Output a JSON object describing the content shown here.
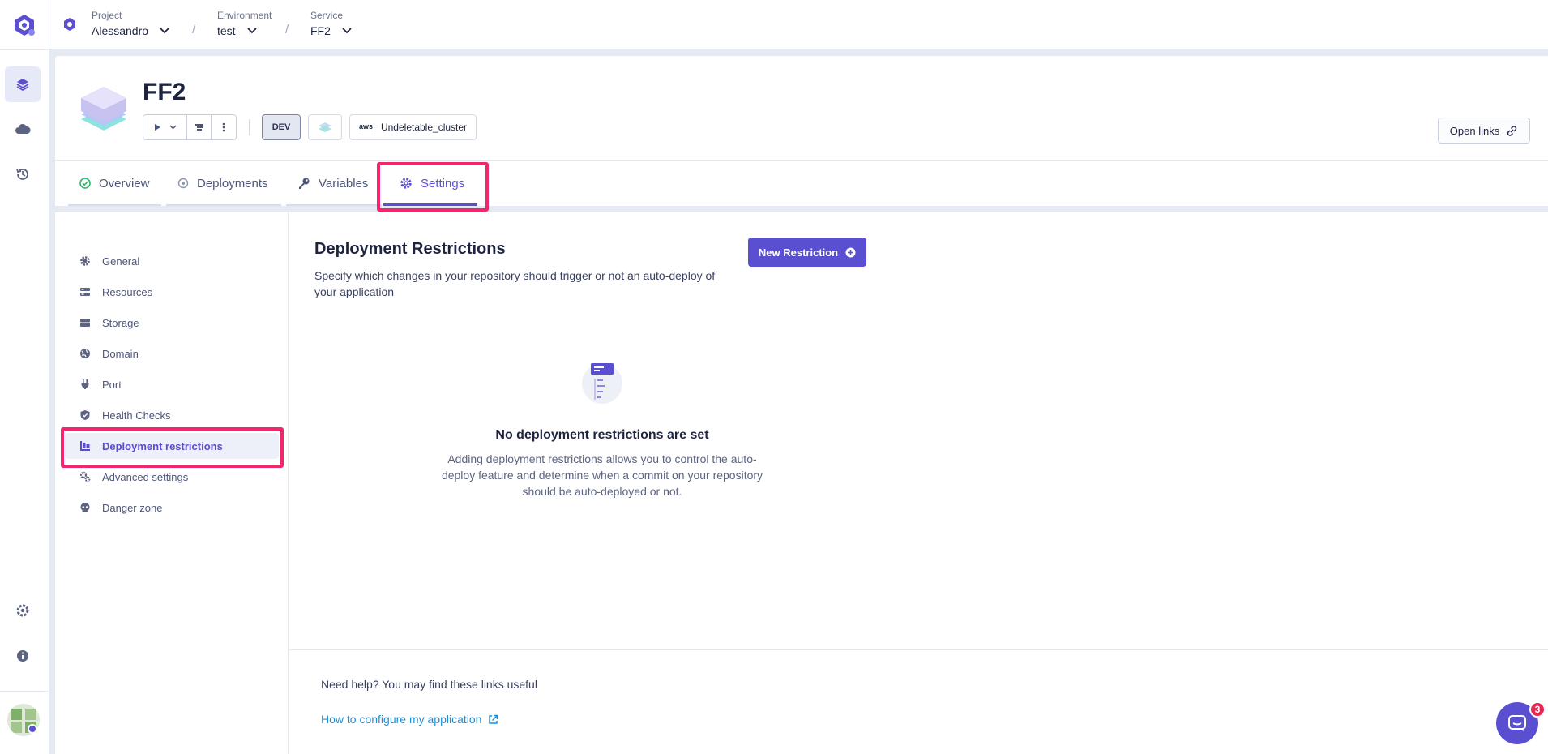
{
  "breadcrumb": {
    "project": {
      "label": "Project",
      "value": "Alessandro"
    },
    "environment": {
      "label": "Environment",
      "value": "test"
    },
    "service": {
      "label": "Service",
      "value": "FF2"
    },
    "separator": "/"
  },
  "app": {
    "title": "FF2",
    "env_badge": "DEV",
    "cluster": "Undeletable_cluster",
    "cluster_provider": "aws",
    "open_links_label": "Open links"
  },
  "tabs": [
    {
      "label": "Overview",
      "icon": "check-circle-icon"
    },
    {
      "label": "Deployments",
      "icon": "circle-dot-icon"
    },
    {
      "label": "Variables",
      "icon": "key-icon"
    },
    {
      "label": "Settings",
      "icon": "gear-icon",
      "active": true
    }
  ],
  "settings_nav": [
    {
      "label": "General",
      "icon": "gear-icon"
    },
    {
      "label": "Resources",
      "icon": "resources-icon"
    },
    {
      "label": "Storage",
      "icon": "storage-icon"
    },
    {
      "label": "Domain",
      "icon": "globe-icon"
    },
    {
      "label": "Port",
      "icon": "plug-icon"
    },
    {
      "label": "Health Checks",
      "icon": "shield-icon"
    },
    {
      "label": "Deployment restrictions",
      "icon": "restriction-icon",
      "active": true
    },
    {
      "label": "Advanced settings",
      "icon": "gears-icon"
    },
    {
      "label": "Danger zone",
      "icon": "skull-icon"
    }
  ],
  "content": {
    "title": "Deployment Restrictions",
    "description": "Specify which changes in your repository should trigger or not an auto-deploy of your application",
    "new_button": "New Restriction",
    "empty_title": "No deployment restrictions are set",
    "empty_text": "Adding deployment restrictions allows you to control the auto-deploy feature and determine when a commit on your repository should be auto-deployed or not."
  },
  "help": {
    "text": "Need help? You may find these links useful",
    "link": "How to configure my application"
  },
  "chat": {
    "badge": "3"
  },
  "colors": {
    "accent": "#5a4fd1",
    "highlight": "#f0266f",
    "link": "#1c8fd6",
    "success": "#2fb36b"
  }
}
